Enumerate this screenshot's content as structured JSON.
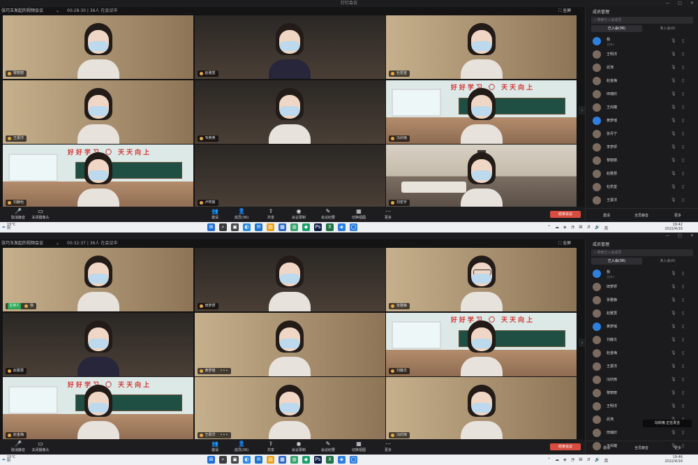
{
  "screenshots": [
    {
      "title": "钉钉会议",
      "meeting_name": "张巧玉发起的视频会议",
      "duration": "00:28:30",
      "attendance": "36人 在会议中",
      "fullscreen_label": "全屏",
      "window_controls": [
        "—",
        "□",
        "✕"
      ],
      "tiles": [
        {
          "name": "黎丽丽",
          "bg": "dorm",
          "person": "light",
          "active": false,
          "host": false,
          "more": false
        },
        {
          "name": "赵雅慧",
          "bg": "dark",
          "person": "dark",
          "active": false,
          "host": false,
          "more": false
        },
        {
          "name": "杜凯莹",
          "bg": "dorm",
          "person": "light",
          "active": false,
          "host": false,
          "more": false
        },
        {
          "name": "王振洋",
          "bg": "dorm",
          "person": "light",
          "active": false,
          "host": false,
          "more": false
        },
        {
          "name": "韦英英",
          "bg": "dark",
          "person": "light",
          "active": false,
          "host": false,
          "more": false
        },
        {
          "name": "冯欣雨",
          "bg": "classroom",
          "person": "light",
          "active": true,
          "host": false,
          "more": false
        },
        {
          "name": "刘静怡",
          "bg": "classroom",
          "person": "light",
          "active": false,
          "host": false,
          "more": false
        },
        {
          "name": "卢珂茹",
          "bg": "dark",
          "person": "none",
          "active": false,
          "host": false,
          "more": false
        },
        {
          "name": "刘宏宇",
          "bg": "room",
          "person": "light",
          "active": false,
          "host": false,
          "more": false
        }
      ],
      "toolbar": [
        {
          "icon": "🎤",
          "label": "取消静音"
        },
        {
          "icon": "▭",
          "label": "关闭摄像头"
        },
        {
          "icon": "👥",
          "label": "邀请"
        },
        {
          "icon": "👤",
          "label": "成员(36)"
        },
        {
          "icon": "⇪",
          "label": "共享"
        },
        {
          "icon": "◉",
          "label": "会议录制"
        },
        {
          "icon": "✎",
          "label": "会议纪要"
        },
        {
          "icon": "▦",
          "label": "切换视图"
        },
        {
          "icon": "⋯",
          "label": "更多"
        }
      ],
      "end_label": "结束会议",
      "panel": {
        "title": "成员管理",
        "search_placeholder": "搜索已入会成员",
        "tab_joined": "已入会(36)",
        "tab_unjoined": "未入会(0)",
        "members": [
          {
            "name": "我",
            "sub": "主持人",
            "me": true
          },
          {
            "name": "王明洋",
            "sub": "",
            "me": false
          },
          {
            "name": "武涛",
            "sub": "",
            "me": false
          },
          {
            "name": "赵金梅",
            "sub": "",
            "me": false
          },
          {
            "name": "田瑞欣",
            "sub": "",
            "me": false
          },
          {
            "name": "王尚婕",
            "sub": "",
            "me": false
          },
          {
            "name": "黄梦瑶",
            "sub": "",
            "me": true
          },
          {
            "name": "张丹宁",
            "sub": "",
            "me": false
          },
          {
            "name": "李梦妍",
            "sub": "",
            "me": false
          },
          {
            "name": "黎丽丽",
            "sub": "",
            "me": false
          },
          {
            "name": "赵雅慧",
            "sub": "",
            "me": false
          },
          {
            "name": "杜凯莹",
            "sub": "",
            "me": false
          },
          {
            "name": "王振洋",
            "sub": "",
            "me": false
          }
        ],
        "invite_label": "邀请",
        "mute_all_label": "全员静音",
        "more_label": "更多"
      },
      "toast": null,
      "taskbar": {
        "temperature": "15°C",
        "weather": "阴",
        "lang": "英",
        "time": "19:42",
        "date": "2022/4/16"
      }
    },
    {
      "title": "",
      "meeting_name": "张巧玉发起的视频会议",
      "duration": "00:32:37",
      "attendance": "36人 在会议中",
      "fullscreen_label": "全屏",
      "window_controls": [
        "—",
        "□",
        "✕"
      ],
      "tiles": [
        {
          "name": "我",
          "bg": "dorm",
          "person": "light",
          "active": false,
          "host": true,
          "more": false
        },
        {
          "name": "田梦妍",
          "bg": "dark",
          "person": "light",
          "active": false,
          "host": false,
          "more": false
        },
        {
          "name": "张雅静",
          "bg": "dorm",
          "person": "glass",
          "active": false,
          "host": false,
          "more": false
        },
        {
          "name": "赵雅慧",
          "bg": "dark",
          "person": "dark",
          "active": false,
          "host": false,
          "more": false
        },
        {
          "name": "黄梦瑶",
          "bg": "dorm",
          "person": "light",
          "active": false,
          "host": false,
          "more": true
        },
        {
          "name": "刘静文",
          "bg": "classroom",
          "person": "light",
          "active": false,
          "host": false,
          "more": false
        },
        {
          "name": "赵金梅",
          "bg": "classroom",
          "person": "light",
          "active": false,
          "host": false,
          "more": false
        },
        {
          "name": "王振洋",
          "bg": "dorm",
          "person": "light",
          "active": false,
          "host": false,
          "more": true
        },
        {
          "name": "冯欣雨",
          "bg": "dorm",
          "person": "light",
          "active": false,
          "host": false,
          "more": false
        }
      ],
      "toolbar": [
        {
          "icon": "🎤",
          "label": "取消静音"
        },
        {
          "icon": "▭",
          "label": "关闭摄像头"
        },
        {
          "icon": "👥",
          "label": "邀请"
        },
        {
          "icon": "👤",
          "label": "成员(36)"
        },
        {
          "icon": "⇪",
          "label": "共享"
        },
        {
          "icon": "◉",
          "label": "会议录制"
        },
        {
          "icon": "✎",
          "label": "会议纪要"
        },
        {
          "icon": "▦",
          "label": "切换视图"
        },
        {
          "icon": "⋯",
          "label": "更多"
        }
      ],
      "end_label": "结束会议",
      "panel": {
        "title": "成员管理",
        "search_placeholder": "搜索已入会成员",
        "tab_joined": "已入会(36)",
        "tab_unjoined": "未入会(0)",
        "members": [
          {
            "name": "我",
            "sub": "主持人",
            "me": true
          },
          {
            "name": "田梦妍",
            "sub": "",
            "me": false
          },
          {
            "name": "张雅静",
            "sub": "",
            "me": false
          },
          {
            "name": "赵雅慧",
            "sub": "",
            "me": false
          },
          {
            "name": "黄梦瑶",
            "sub": "",
            "me": true
          },
          {
            "name": "刘静文",
            "sub": "",
            "me": false
          },
          {
            "name": "赵金梅",
            "sub": "",
            "me": false
          },
          {
            "name": "王振洋",
            "sub": "",
            "me": false
          },
          {
            "name": "冯欣雨",
            "sub": "",
            "me": false
          },
          {
            "name": "黎丽丽",
            "sub": "",
            "me": false
          },
          {
            "name": "王明洋",
            "sub": "",
            "me": false
          },
          {
            "name": "武涛",
            "sub": "",
            "me": false
          },
          {
            "name": "田瑞欣",
            "sub": "",
            "me": false
          },
          {
            "name": "王尚婕",
            "sub": "",
            "me": false
          }
        ],
        "invite_label": "邀请",
        "mute_all_label": "全员静音",
        "more_label": "更多"
      },
      "toast": "冯欣雨 正在发言",
      "taskbar": {
        "temperature": "15°C",
        "weather": "阴",
        "lang": "英",
        "time": "19:46",
        "date": "2022/4/16"
      }
    }
  ],
  "classroom_banner": "好好学习 〇 天天向上",
  "taskbar_apps": [
    {
      "glyph": "⊞",
      "color": "#1f6fd6",
      "name": "start"
    },
    {
      "glyph": "⌕",
      "color": "#3a3a3a",
      "name": "search"
    },
    {
      "glyph": "▣",
      "color": "#444444",
      "name": "task-view"
    },
    {
      "glyph": "◐",
      "color": "#2c8ae8",
      "name": "edge"
    },
    {
      "glyph": "✉",
      "color": "#1c73c9",
      "name": "mail"
    },
    {
      "glyph": "▤",
      "color": "#e3a21a",
      "name": "explorer"
    },
    {
      "glyph": "▩",
      "color": "#2a66c4",
      "name": "store"
    },
    {
      "glyph": "◍",
      "color": "#39a36b",
      "name": "chrome"
    },
    {
      "glyph": "◆",
      "color": "#1aa06a",
      "name": "app-green"
    },
    {
      "glyph": "Ps",
      "color": "#0b1f45",
      "name": "photoshop"
    },
    {
      "glyph": "X",
      "color": "#1d7345",
      "name": "excel"
    },
    {
      "glyph": "◈",
      "color": "#2a7de1",
      "name": "dingtalk"
    },
    {
      "glyph": "◯",
      "color": "#2f7fe0",
      "name": "app-blue"
    }
  ],
  "tray_glyphs": [
    "⌃",
    "☁",
    "◈",
    "◔",
    "⌘",
    "⇵",
    "🔊"
  ]
}
